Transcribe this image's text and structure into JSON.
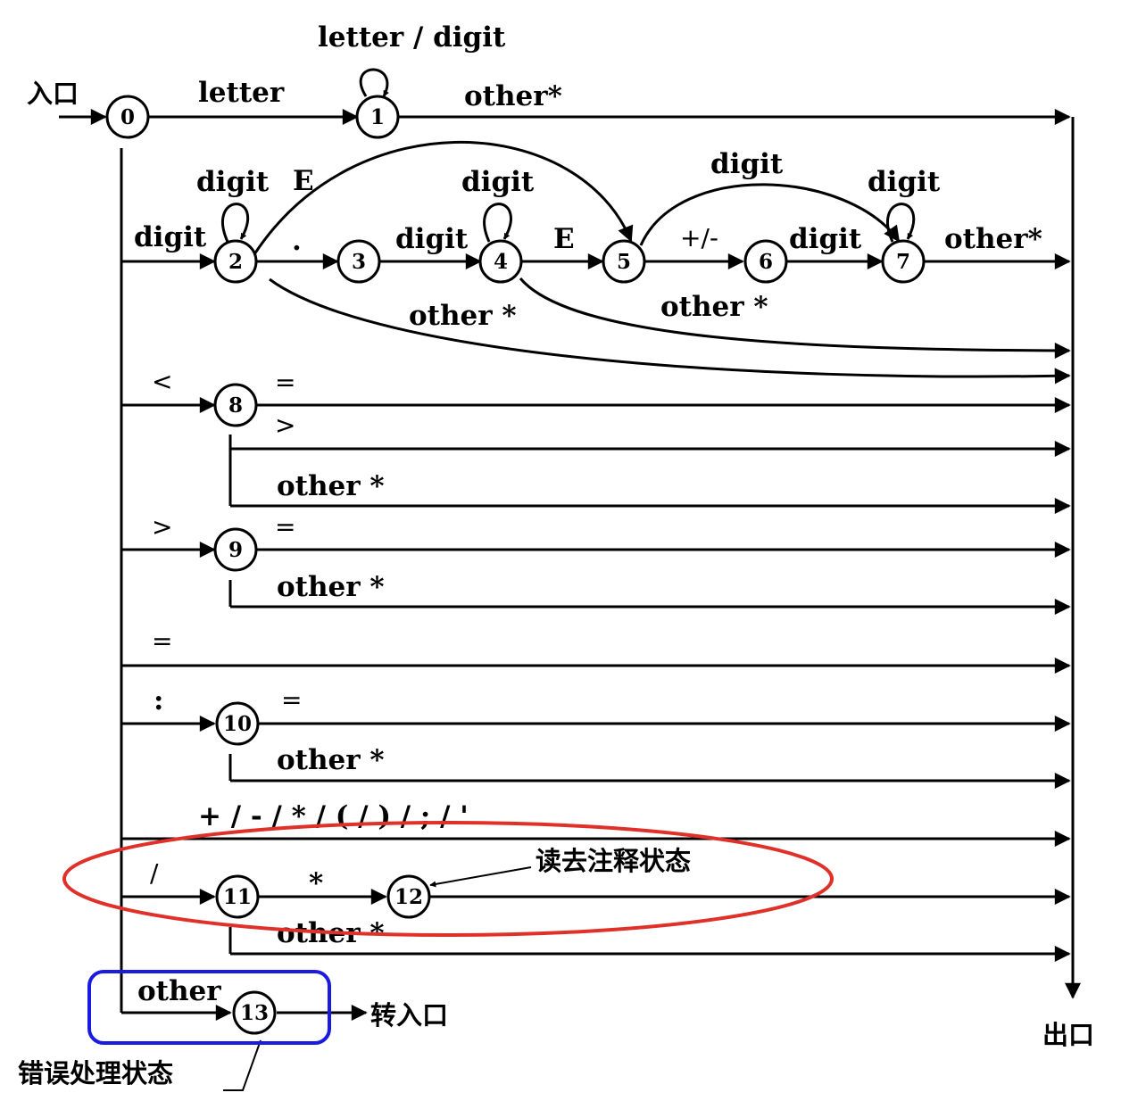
{
  "entry_label": "入口",
  "exit_label": "出口",
  "goto_entry_label": "转入口",
  "comment_state_label": "读去注释状态",
  "error_state_label": "错误处理状态",
  "highlight_colors": {
    "comment_ellipse": "#e0302a",
    "error_box": "#1a1ae0"
  },
  "states": [
    "0",
    "1",
    "2",
    "3",
    "4",
    "5",
    "6",
    "7",
    "8",
    "9",
    "10",
    "11",
    "12",
    "13"
  ],
  "transitions": {
    "letter": "letter",
    "letter_or_digit": "letter / digit",
    "other_star": "other*",
    "other_star_spaced": "other *",
    "digit": "digit",
    "E": "E",
    "dot": ".",
    "plus_minus": "+/-",
    "lt": "<",
    "gt": ">",
    "eq": "=",
    "colon": ":",
    "ops": "+ / - / * / ( / ) / ; / '",
    "slash": "/",
    "star": "*",
    "other": "other"
  }
}
